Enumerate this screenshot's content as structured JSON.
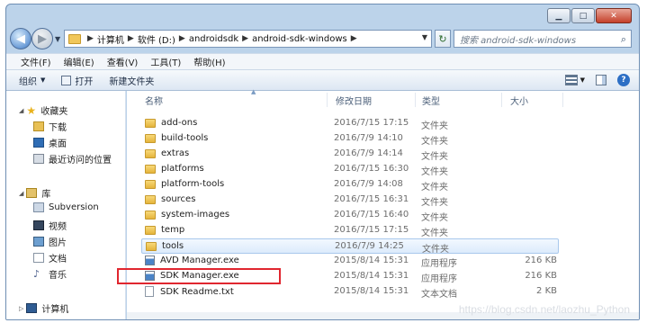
{
  "window": {
    "minimize_glyph": "▁",
    "maximize_glyph": "□",
    "close_glyph": "✕"
  },
  "address": {
    "crumbs": [
      "计算机",
      "软件 (D:)",
      "androidsdk",
      "android-sdk-windows"
    ],
    "search_placeholder": "搜索 android-sdk-windows"
  },
  "menubar": [
    "文件(F)",
    "编辑(E)",
    "查看(V)",
    "工具(T)",
    "帮助(H)"
  ],
  "toolbar": {
    "organize": "组织",
    "open": "打开",
    "new_folder": "新建文件夹"
  },
  "navpane": {
    "favorites": "收藏夹",
    "downloads": "下载",
    "desktop": "桌面",
    "recent": "最近访问的位置",
    "libraries": "库",
    "subversion": "Subversion",
    "videos": "视频",
    "pictures": "图片",
    "documents": "文档",
    "music": "音乐",
    "computer": "计算机"
  },
  "columns": {
    "name": "名称",
    "date": "修改日期",
    "type": "类型",
    "size": "大小"
  },
  "files": [
    {
      "name": "add-ons",
      "date": "2016/7/15 17:15",
      "type": "文件夹",
      "size": "",
      "icon": "folder-icon"
    },
    {
      "name": "build-tools",
      "date": "2016/7/9 14:10",
      "type": "文件夹",
      "size": "",
      "icon": "folder-icon"
    },
    {
      "name": "extras",
      "date": "2016/7/9 14:14",
      "type": "文件夹",
      "size": "",
      "icon": "folder-icon"
    },
    {
      "name": "platforms",
      "date": "2016/7/15 16:30",
      "type": "文件夹",
      "size": "",
      "icon": "folder-icon"
    },
    {
      "name": "platform-tools",
      "date": "2016/7/9 14:08",
      "type": "文件夹",
      "size": "",
      "icon": "folder-icon"
    },
    {
      "name": "sources",
      "date": "2016/7/15 16:31",
      "type": "文件夹",
      "size": "",
      "icon": "folder-icon"
    },
    {
      "name": "system-images",
      "date": "2016/7/15 16:40",
      "type": "文件夹",
      "size": "",
      "icon": "folder-icon"
    },
    {
      "name": "temp",
      "date": "2016/7/15 17:15",
      "type": "文件夹",
      "size": "",
      "icon": "folder-icon"
    },
    {
      "name": "tools",
      "date": "2016/7/9 14:25",
      "type": "文件夹",
      "size": "",
      "icon": "folder-icon"
    },
    {
      "name": "AVD Manager.exe",
      "date": "2015/8/14 15:31",
      "type": "应用程序",
      "size": "216 KB",
      "icon": "app-icon"
    },
    {
      "name": "SDK Manager.exe",
      "date": "2015/8/14 15:31",
      "type": "应用程序",
      "size": "216 KB",
      "icon": "app-icon"
    },
    {
      "name": "SDK Readme.txt",
      "date": "2015/8/14 15:31",
      "type": "文本文档",
      "size": "2 KB",
      "icon": "file-icon"
    }
  ],
  "watermark": "https://blog.csdn.net/laozhu_Python"
}
